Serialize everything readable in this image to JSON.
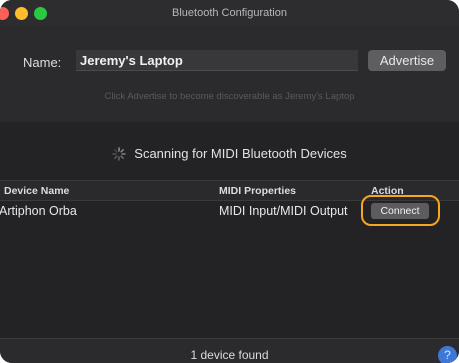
{
  "window": {
    "title": "Bluetooth Configuration"
  },
  "advertise_panel": {
    "name_label": "Name:",
    "name_value": "Jeremy's Laptop",
    "advertise_label": "Advertise",
    "hint": "Click Advertise to become discoverable as Jeremy's Laptop"
  },
  "scan": {
    "status": "Scanning for MIDI Bluetooth Devices",
    "icon": "spinner-icon"
  },
  "table": {
    "columns": [
      "Device Name",
      "MIDI Properties",
      "Action"
    ],
    "rows": [
      {
        "device_name": "Artiphon Orba",
        "midi_properties": "MIDI Input/MIDI Output",
        "action_label": "Connect"
      }
    ]
  },
  "footer": {
    "status": "1 device found",
    "help_label": "?"
  },
  "colors": {
    "window_bg": "#232325",
    "highlight": "#f5a623",
    "help_blue": "#3d78d8",
    "close": "#ff5f57",
    "minimize": "#febc2e",
    "maximize": "#28c840"
  }
}
